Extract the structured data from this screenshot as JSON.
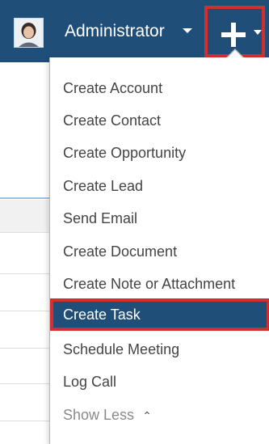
{
  "topbar": {
    "user_name": "Administrator",
    "avatar_icon": "user-avatar",
    "quick_create_icon": "plus-icon",
    "accent": "#1f4e79",
    "highlight": "#d32f2f"
  },
  "menu": {
    "items": [
      {
        "label": "Create Account"
      },
      {
        "label": "Create Contact"
      },
      {
        "label": "Create Opportunity"
      },
      {
        "label": "Create Lead"
      },
      {
        "label": "Send Email"
      },
      {
        "label": "Create Document"
      },
      {
        "label": "Create Note or Attachment"
      },
      {
        "label": "Create Task",
        "active": true
      },
      {
        "label": "Schedule Meeting"
      },
      {
        "label": "Log Call"
      }
    ],
    "show_less_label": "Show Less",
    "show_less_icon": "double-chevron-up-icon"
  }
}
